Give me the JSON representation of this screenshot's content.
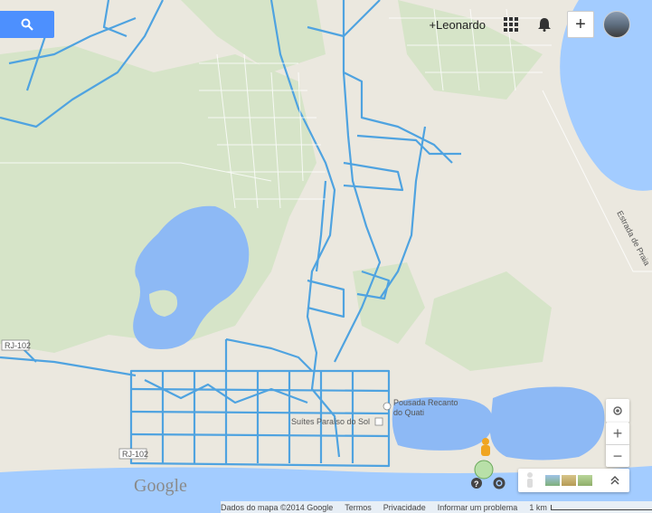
{
  "header": {
    "user_link": "+Leonardo",
    "apps_icon": "apps-grid-icon",
    "notifications_icon": "bell-icon",
    "share_icon": "plus-icon",
    "share_label": "+"
  },
  "search": {
    "icon": "search-icon"
  },
  "map": {
    "road_labels": [
      "RJ-102",
      "RJ-102",
      "Estrada de Praia"
    ],
    "places": [
      {
        "name": "Pousada Recanto do Quati",
        "line1": "Pousada Recanto",
        "line2": "do Quati"
      },
      {
        "name": "Suítes Paraíso do Sol",
        "line1": "Suítes Paraíso do Sol"
      }
    ],
    "logo": "Google",
    "colors": {
      "land": "#ebe8df",
      "green": "#d4e4c6",
      "water": "#a3ccff",
      "lagoon": "#8db9f5",
      "street_highlight": "#4fa3e0",
      "street": "#ffffff"
    }
  },
  "controls": {
    "locate_icon": "crosshair-icon",
    "zoom_in": "+",
    "zoom_out": "−",
    "pegman_icon": "pegman-icon",
    "help_icon": "help-icon",
    "settings_icon": "gear-icon",
    "collapse_icon": "double-chevron-up-icon"
  },
  "footer": {
    "map_data": "Dados do mapa ©2014 Google",
    "terms": "Termos",
    "privacy": "Privacidade",
    "report": "Informar um problema",
    "scale": "1 km"
  }
}
